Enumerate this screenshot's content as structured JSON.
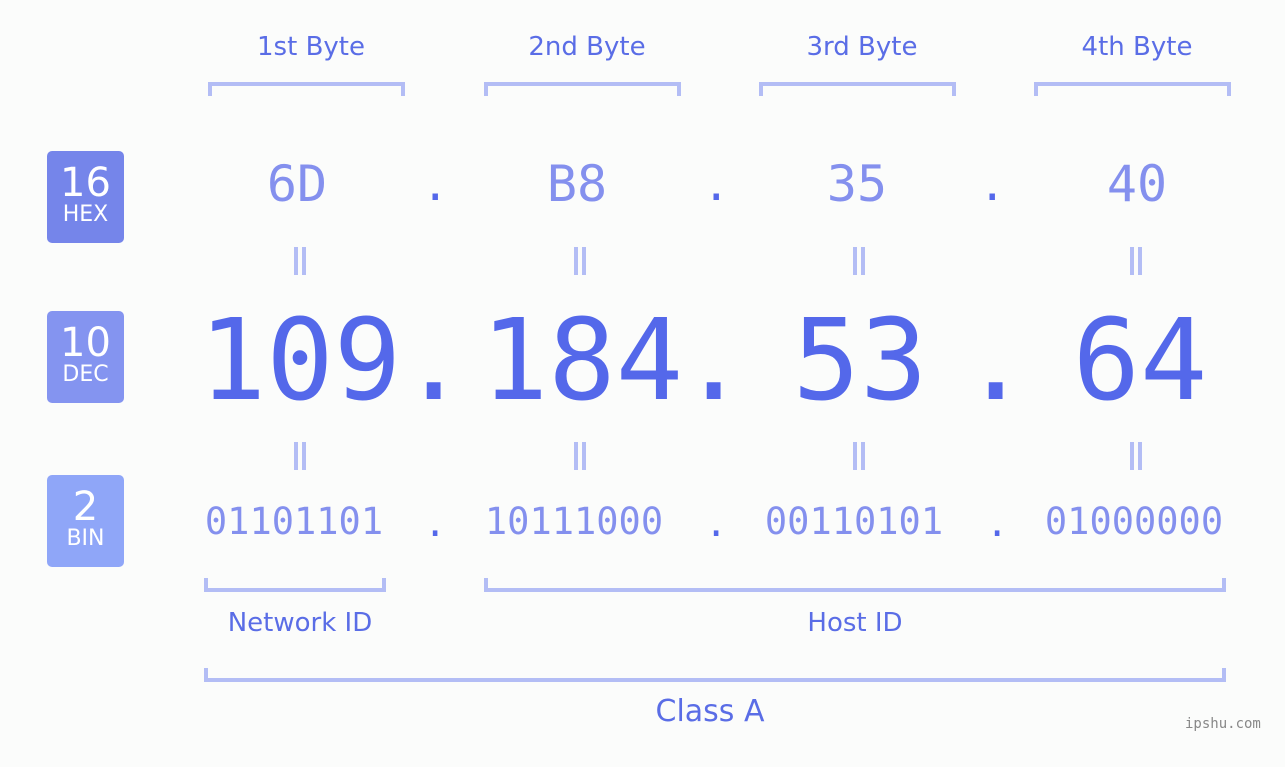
{
  "byte_headers": [
    "1st Byte",
    "2nd Byte",
    "3rd Byte",
    "4th Byte"
  ],
  "badges": {
    "hex": {
      "num": "16",
      "label": "HEX",
      "color": "#7585ea"
    },
    "dec": {
      "num": "10",
      "label": "DEC",
      "color": "#8494f0"
    },
    "bin": {
      "num": "2",
      "label": "BIN",
      "color": "#8fa6f8"
    }
  },
  "hex": [
    "6D",
    "B8",
    "35",
    "40"
  ],
  "dec": [
    "109",
    "184",
    "53",
    "64"
  ],
  "bin": [
    "01101101",
    "10111000",
    "00110101",
    "01000000"
  ],
  "separator": ".",
  "network_id_label": "Network ID",
  "host_id_label": "Host ID",
  "class_label": "Class A",
  "watermark": "ipshu.com"
}
